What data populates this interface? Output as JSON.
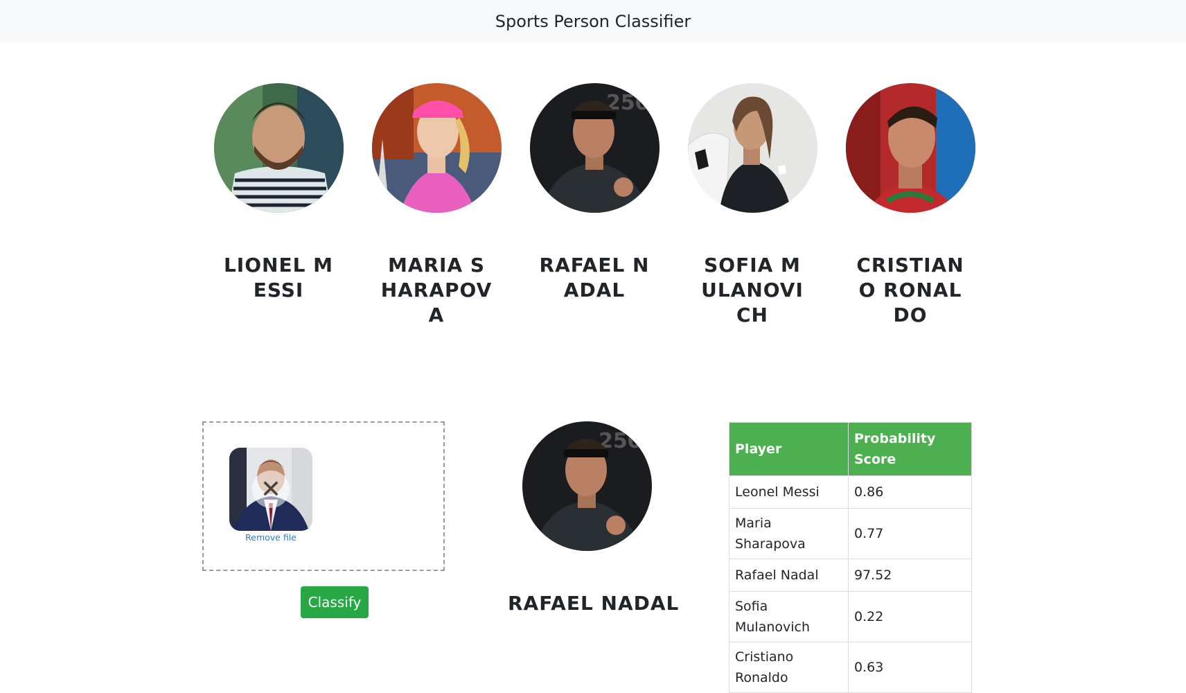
{
  "navbar": {
    "title": "Sports Person Classifier"
  },
  "players": [
    {
      "name": "LIONEL MESSI",
      "avatar_icon": "lionel-messi-photo"
    },
    {
      "name": "MARIA SHARAPOVA",
      "avatar_icon": "maria-sharapova-photo"
    },
    {
      "name": "RAFAEL NADAL",
      "avatar_icon": "rafael-nadal-photo"
    },
    {
      "name": "SOFIA MULANOVICH",
      "avatar_icon": "sofia-mulanovich-photo"
    },
    {
      "name": "CRISTIANO RONALDO",
      "avatar_icon": "cristiano-ronaldo-photo"
    }
  ],
  "upload": {
    "remove_label": "Remove file",
    "remove_icon": "close-icon",
    "classify_label": "Classify"
  },
  "result": {
    "name": "RAFAEL NADAL"
  },
  "table": {
    "headers": [
      "Player",
      "Probability Score"
    ],
    "rows": [
      [
        "Leonel Messi",
        "0.86"
      ],
      [
        "Maria Sharapova",
        "0.77"
      ],
      [
        "Rafael Nadal",
        "97.52"
      ],
      [
        "Sofia Mulanovich",
        "0.22"
      ],
      [
        "Cristiano Ronaldo",
        "0.63"
      ]
    ]
  },
  "colors": {
    "navbar_bg": "#f8f9fa",
    "header_green": "#4caf50",
    "button_green": "#28a745",
    "link_blue": "#2b7bd8"
  }
}
